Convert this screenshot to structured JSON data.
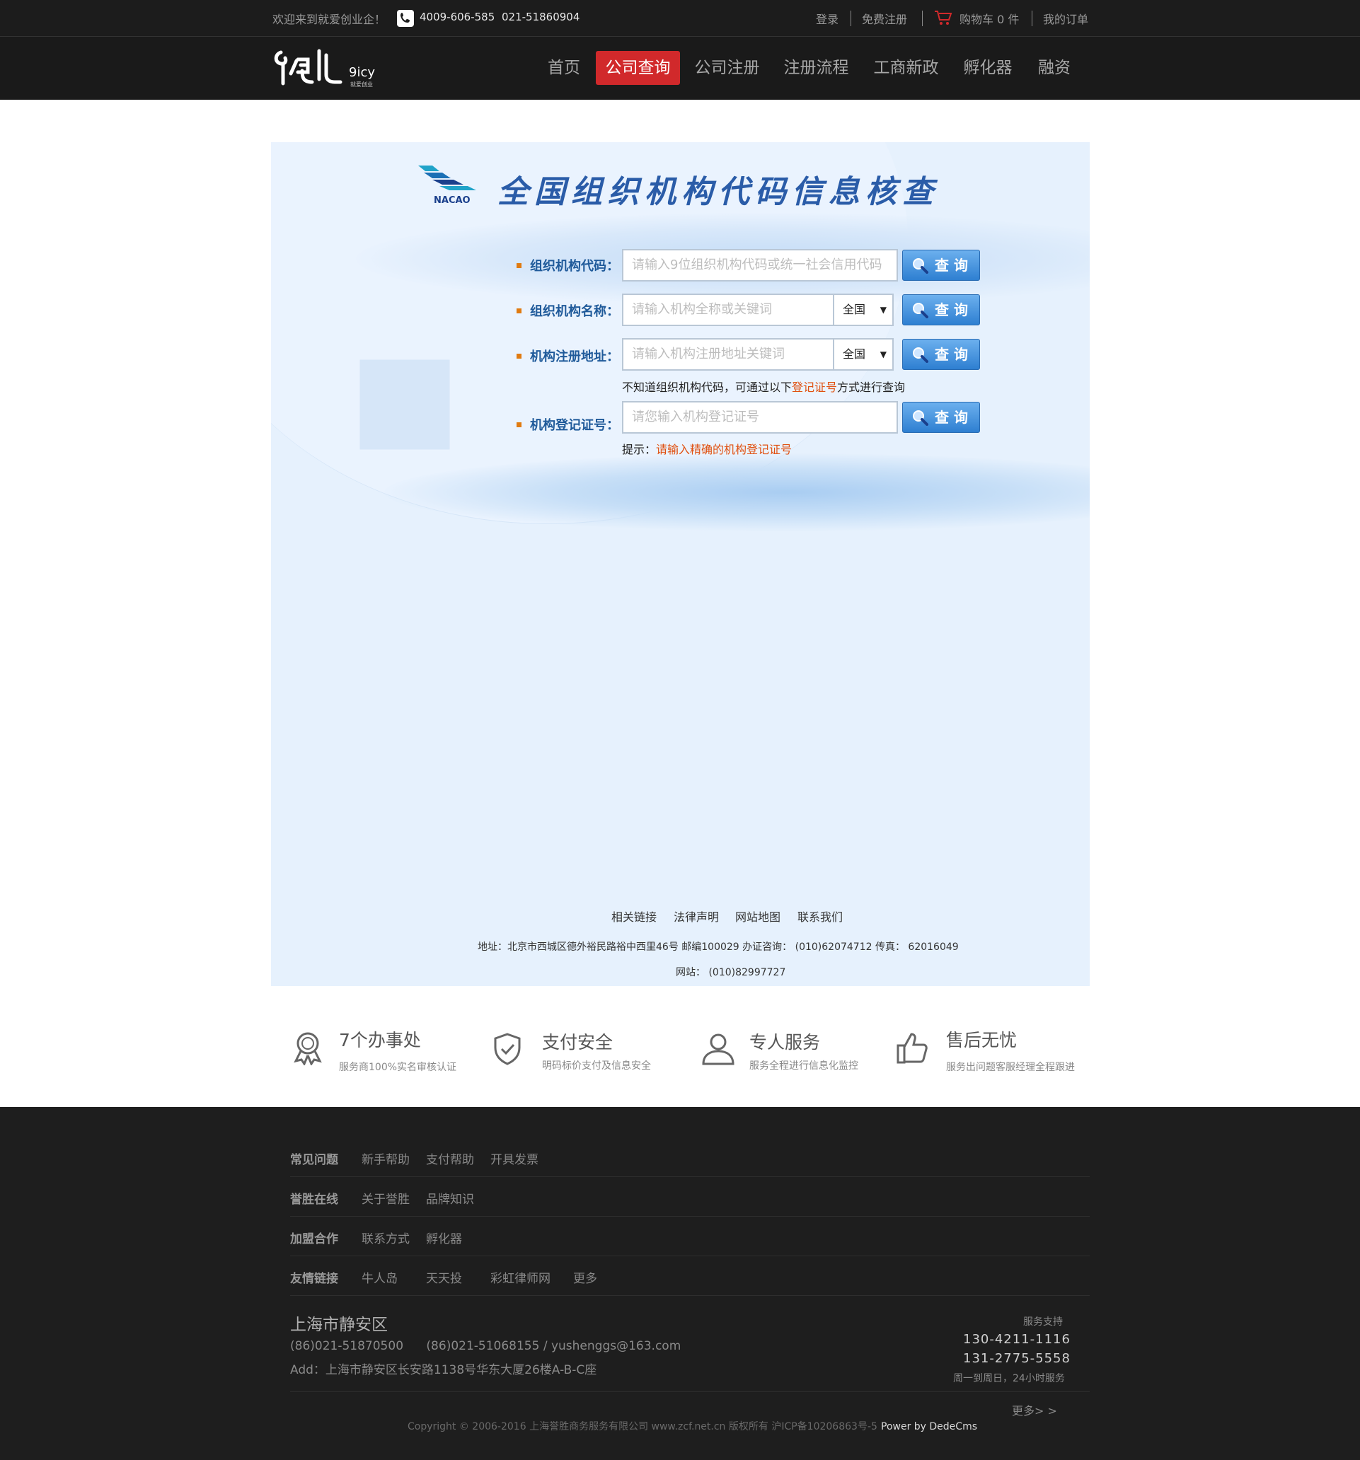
{
  "topbar": {
    "welcome": "欢迎来到就爱创业企！",
    "phone1": "4009-606-585",
    "phone2": "021-51860904",
    "login": "登录",
    "register": "免费注册",
    "cart": "购物车 0 件",
    "orders": "我的订单"
  },
  "logo": {
    "main": "创业",
    "sub": "9icy",
    "tagline": "就爱创业"
  },
  "nav": [
    {
      "label": "首页"
    },
    {
      "label": "公司查询"
    },
    {
      "label": "公司注册"
    },
    {
      "label": "注册流程"
    },
    {
      "label": "工商新政"
    },
    {
      "label": "孵化器"
    },
    {
      "label": "融资"
    }
  ],
  "panel": {
    "banner_logo_text": "NACAO",
    "banner_title": "全国组织机构代码信息核查",
    "rows": [
      {
        "label": "组织机构代码：",
        "placeholder": "请输入9位组织机构代码或统一社会信用代码"
      },
      {
        "label": "组织机构名称：",
        "placeholder": "请输入机构全称或关键词",
        "select": "全国"
      },
      {
        "label": "机构注册地址：",
        "placeholder": "请输入机构注册地址关键词",
        "select": "全国"
      },
      {
        "label": "机构登记证号：",
        "placeholder": "请您输入机构登记证号"
      }
    ],
    "query_label": "查 询",
    "hint_prefix": "不知道组织机构代码，可通过以下",
    "hint_link": "登记证号",
    "hint_suffix": "方式进行查询",
    "tip_prefix": "提示：",
    "tip_text": "请输入精确的机构登记证号",
    "footer_links": [
      "相关链接",
      "法律声明",
      "网站地图",
      "联系我们"
    ],
    "address_line": "地址：北京市西城区德外裕民路裕中西里46号  邮编100029  办证咨询：  (010)62074712  传真：  62016049",
    "site_line": "网站：  (010)82997727"
  },
  "features": [
    {
      "icon": "medal-icon",
      "title": "7个办事处",
      "sub": "服务商100%实名审核认证"
    },
    {
      "icon": "shield-check-icon",
      "title": "支付安全",
      "sub": "明码标价支付及信息安全"
    },
    {
      "icon": "user-icon",
      "title": "专人服务",
      "sub": "服务全程进行信息化监控"
    },
    {
      "icon": "thumbs-up-icon",
      "title": "售后无忧",
      "sub": "服务出问题客服经理全程跟进"
    }
  ],
  "footer": {
    "groups": [
      {
        "title": "常见问题",
        "items": [
          "新手帮助",
          "支付帮助",
          "开具发票"
        ]
      },
      {
        "title": "誉胜在线",
        "items": [
          "关于誉胜",
          "品牌知识"
        ]
      },
      {
        "title": "加盟合作",
        "items": [
          "联系方式",
          "孵化器"
        ]
      },
      {
        "title": "友情链接",
        "items": [
          "牛人岛",
          "天天投",
          "彩虹律师网",
          "更多"
        ]
      }
    ],
    "city": "上海市静安区",
    "contact": "(86)021-51870500      (86)021-51068155 / yushenggs@163.com",
    "address": "Add：上海市静安区长安路1138号华东大厦26楼A-B-C座",
    "support_label": "服务支持",
    "support_phone1": "130-4211-1116",
    "support_phone2": "131-2775-5558",
    "support_hours": "周一到周日，24小时服务",
    "more": "更多> >",
    "copyright": "Copyright © 2006-2016 上海誉胜商务服务有限公司 www.zcf.net.cn  版权所有  沪ICP备10206863号-5",
    "powered": "Power by DedeCms"
  },
  "colors": {
    "accent": "#d1292b",
    "panel_bg": "#e6f1fd",
    "label_blue": "#1f5a9a",
    "hint_red": "#e05010"
  }
}
